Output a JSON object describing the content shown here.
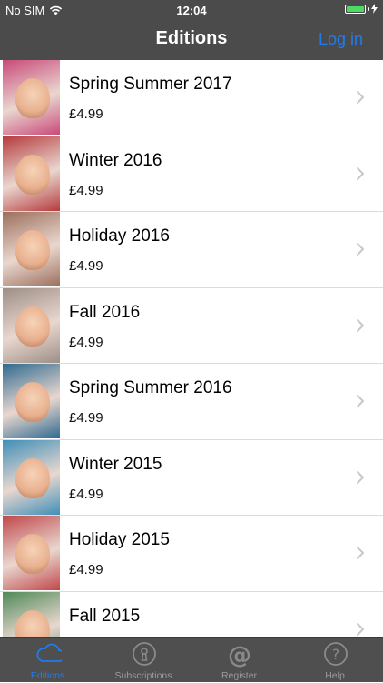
{
  "status_bar": {
    "carrier": "No SIM",
    "time": "12:04"
  },
  "nav": {
    "title": "Editions",
    "login_label": "Log in"
  },
  "editions": [
    {
      "title": "Spring Summer 2017",
      "price": "£4.99",
      "cover_color": "#c94a7a"
    },
    {
      "title": "Winter 2016",
      "price": "£4.99",
      "cover_color": "#b63b3e"
    },
    {
      "title": "Holiday 2016",
      "price": "£4.99",
      "cover_color": "#9c6f5c"
    },
    {
      "title": "Fall 2016",
      "price": "£4.99",
      "cover_color": "#9d8f86"
    },
    {
      "title": "Spring Summer 2016",
      "price": "£4.99",
      "cover_color": "#2f6a8f"
    },
    {
      "title": "Winter 2015",
      "price": "£4.99",
      "cover_color": "#3f8fb8"
    },
    {
      "title": "Holiday 2015",
      "price": "£4.99",
      "cover_color": "#c0474a"
    },
    {
      "title": "Fall 2015",
      "price": "",
      "cover_color": "#4f8a58"
    }
  ],
  "tabs": [
    {
      "label": "Editions",
      "icon": "cloud-icon",
      "active": true
    },
    {
      "label": "Subscriptions",
      "icon": "keyhole-icon",
      "active": false
    },
    {
      "label": "Register",
      "icon": "at-sign-icon",
      "active": false
    },
    {
      "label": "Help",
      "icon": "question-icon",
      "active": false
    }
  ],
  "colors": {
    "accent": "#1e7cf0",
    "bar": "#4b4b4b"
  }
}
